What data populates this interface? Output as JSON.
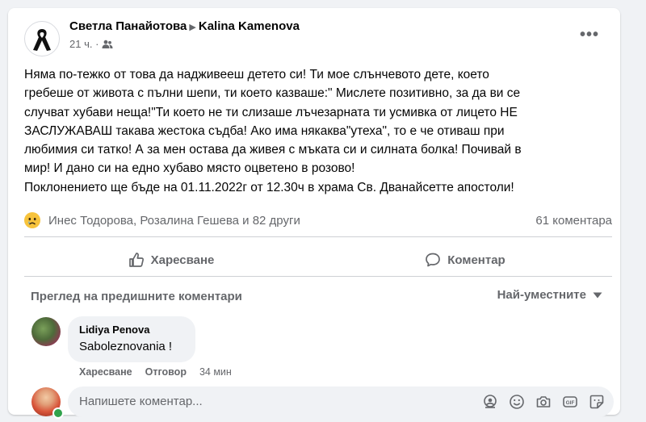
{
  "post": {
    "author": "Светла Панайотова",
    "target": "Kalina Kamenova",
    "time": "21 ч. ·",
    "text": "Няма по-тежко от това да надживееш детето си! Ти мое слънчевото дете, което\nгребеше от живота с пълни шепи, ти което казваше:\" Мислете позитивно, за да ви се\nслучват хубави неща!\"Ти което не ти слизаше лъчезарната ти усмивка от лицето НЕ\nЗАСЛУЖАВАШ такава жестока съдба! Ако има някаква\"утеха\", то е че отиваш при\nлюбимия си татко! А за мен остава да живея с мъката си и силната болка! Почивай в\nмир! И дано си на едно хубаво място оцветено в розово!\nПоклонението ще бъде на 01.11.2022г от 12.30ч в храма Св. Дванайсетте апостоли!"
  },
  "reactions": {
    "names": "Инес Тодорова, Розалина Гешева и 82 други",
    "comments_count": "61 коментара"
  },
  "actions": {
    "like": "Харесване",
    "comment": "Коментар"
  },
  "comments_section": {
    "view_previous": "Преглед на предишните коментари",
    "sort_label": "Най-уместните"
  },
  "comment": {
    "author": "Lidiya Penova",
    "text": "Saboleznovania !",
    "like": "Харесване",
    "reply": "Отговор",
    "time": "34 мин"
  },
  "composer": {
    "placeholder": "Напишете коментар..."
  }
}
